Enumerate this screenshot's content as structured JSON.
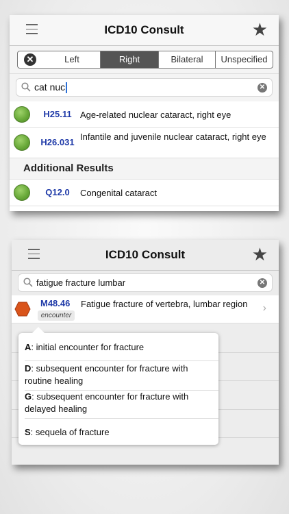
{
  "screen1": {
    "title": "ICD10 Consult",
    "laterality": {
      "clear_icon": "clear-filter-icon",
      "segments": [
        "Left",
        "Right",
        "Bilateral",
        "Unspecified"
      ],
      "selected": "Right"
    },
    "search": {
      "query": "cat nuc"
    },
    "results": [
      {
        "code": "H25.11",
        "description": "Age-related nuclear cataract, right eye",
        "status": "green-dot"
      },
      {
        "code": "H26.031",
        "description": "Infantile and juvenile nuclear cataract, right eye",
        "status": "green-dot"
      }
    ],
    "additional_header": "Additional Results",
    "additional_results": [
      {
        "code": "Q12.0",
        "description": "Congenital cataract",
        "status": "green-dot"
      }
    ]
  },
  "screen2": {
    "title": "ICD10 Consult",
    "search": {
      "query": "fatigue fracture lumbar"
    },
    "result": {
      "code": "M48.46",
      "badge": "encounter",
      "description": "Fatigue fracture of vertebra, lumbar region",
      "status": "orange-hexagon"
    },
    "encounter_options": [
      {
        "key": "A",
        "text": ": initial encounter for fracture"
      },
      {
        "key": "D",
        "text": ": subsequent encounter for fracture with routine healing"
      },
      {
        "key": "G",
        "text": ": subsequent encounter for fracture with delayed healing"
      },
      {
        "key": "S",
        "text": ": sequela of fracture"
      }
    ]
  },
  "colors": {
    "code_blue": "#1f3aa8",
    "status_green": "#6aaa3a",
    "status_orange": "#d9541b",
    "segment_selected": "#555555"
  }
}
